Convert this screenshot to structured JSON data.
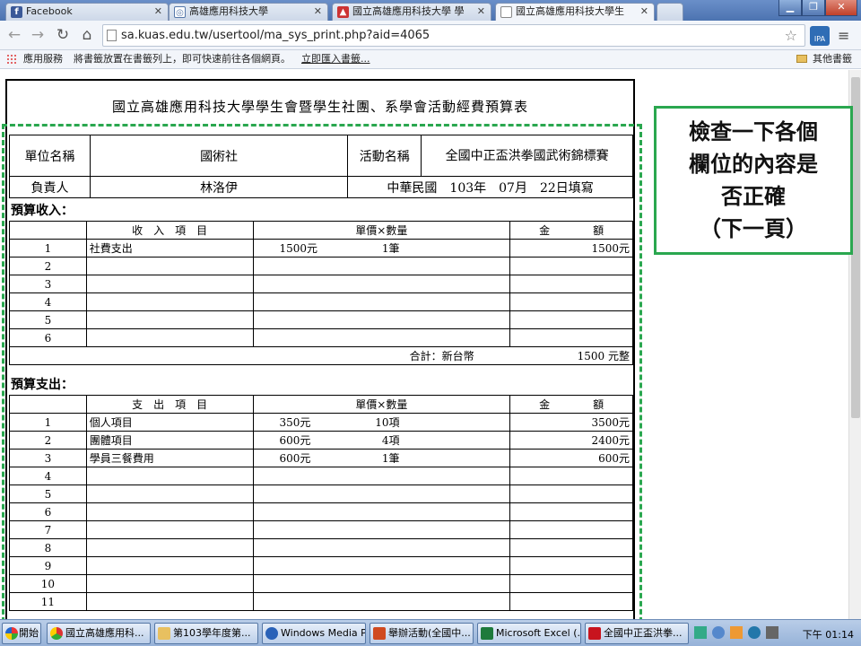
{
  "browser": {
    "tabs": [
      {
        "label": "Facebook",
        "icon": "facebook-icon"
      },
      {
        "label": "高雄應用科技大學",
        "icon": "globe-icon"
      },
      {
        "label": "國立高雄應用科技大學 學",
        "icon": "kuas-icon"
      },
      {
        "label": "國立高雄應用科技大學生",
        "icon": "page-icon"
      }
    ],
    "url": "sa.kuas.edu.tw/usertool/ma_sys_print.php?aid=4065",
    "bookmarks": {
      "apps_label": "應用服務",
      "hint": "將書籤放置在書籤列上，即可快速前往各個網頁。",
      "import_link": "立即匯入書籤...",
      "other": "其他書籤"
    }
  },
  "doc": {
    "title": "國立高雄應用科技大學學生會暨學生社團、系學會活動經費預算表",
    "info": {
      "unit_label": "單位名稱",
      "unit_value": "國術社",
      "activity_label": "活動名稱",
      "activity_value": "全國中正盃洪拳國武術錦標賽",
      "leader_label": "負責人",
      "leader_value": "林洛伊",
      "date_text": "中華民國　103年　07月　22日填寫"
    },
    "income": {
      "section_title": "預算收入：",
      "headers": [
        "",
        "收　入　項　目",
        "單價×數量",
        "金　　　　額"
      ],
      "rows": [
        {
          "no": "1",
          "item": "社費支出",
          "price": "1500元",
          "qty": "1筆",
          "amount": "1500元"
        },
        {
          "no": "2",
          "item": "",
          "price": "",
          "qty": "",
          "amount": ""
        },
        {
          "no": "3",
          "item": "",
          "price": "",
          "qty": "",
          "amount": ""
        },
        {
          "no": "4",
          "item": "",
          "price": "",
          "qty": "",
          "amount": ""
        },
        {
          "no": "5",
          "item": "",
          "price": "",
          "qty": "",
          "amount": ""
        },
        {
          "no": "6",
          "item": "",
          "price": "",
          "qty": "",
          "amount": ""
        }
      ],
      "total_label": "合計：新台幣",
      "total_value": "1500 元整"
    },
    "expense": {
      "section_title": "預算支出：",
      "headers": [
        "",
        "支　出　項　目",
        "單價×數量",
        "金　　　　額"
      ],
      "rows": [
        {
          "no": "1",
          "item": "個人項目",
          "price": "350元",
          "qty": "10項",
          "amount": "3500元"
        },
        {
          "no": "2",
          "item": "團體項目",
          "price": "600元",
          "qty": "4項",
          "amount": "2400元"
        },
        {
          "no": "3",
          "item": "學員三餐費用",
          "price": "600元",
          "qty": "1筆",
          "amount": "600元"
        },
        {
          "no": "4",
          "item": "",
          "price": "",
          "qty": "",
          "amount": ""
        },
        {
          "no": "5",
          "item": "",
          "price": "",
          "qty": "",
          "amount": ""
        },
        {
          "no": "6",
          "item": "",
          "price": "",
          "qty": "",
          "amount": ""
        },
        {
          "no": "7",
          "item": "",
          "price": "",
          "qty": "",
          "amount": ""
        },
        {
          "no": "8",
          "item": "",
          "price": "",
          "qty": "",
          "amount": ""
        },
        {
          "no": "9",
          "item": "",
          "price": "",
          "qty": "",
          "amount": ""
        },
        {
          "no": "10",
          "item": "",
          "price": "",
          "qty": "",
          "amount": ""
        },
        {
          "no": "11",
          "item": "",
          "price": "",
          "qty": "",
          "amount": ""
        }
      ]
    }
  },
  "note": {
    "lines": [
      "檢查一下各個",
      "欄位的內容是",
      "否正確",
      "（下一頁）"
    ],
    "color": "#2aa74f"
  },
  "taskbar": {
    "start": "開始",
    "items": [
      {
        "label": "國立高雄應用科...",
        "icon": "chrome-icon"
      },
      {
        "label": "第103學年度第...",
        "icon": "folder-icon"
      },
      {
        "label": "Windows Media Pl...",
        "icon": "media-player-icon"
      },
      {
        "label": "舉辦活動(全國中...",
        "icon": "powerpoint-icon"
      },
      {
        "label": "Microsoft Excel (...",
        "icon": "excel-icon"
      },
      {
        "label": "全國中正盃洪拳...",
        "icon": "pdf-icon"
      }
    ],
    "clock": "下午 01:14"
  }
}
